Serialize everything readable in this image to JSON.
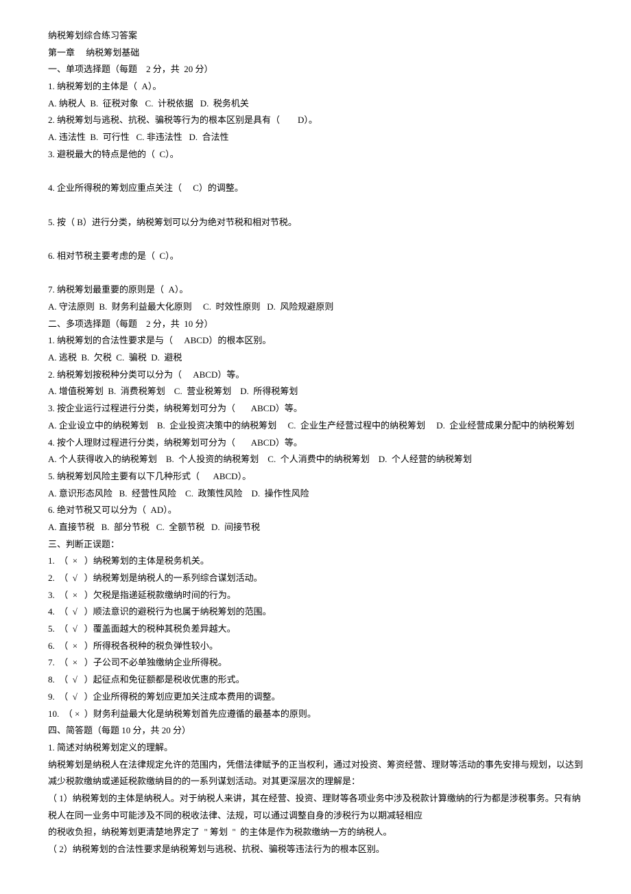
{
  "lines": [
    "纳税筹划综合练习答案",
    "第一章     纳税筹划基础",
    "一、单项选择题（每题    2 分，共  20 分）",
    "1. 纳税筹划的主体是（  A）。",
    "A. 纳税人  B.  征税对象   C.  计税依据   D.  税务机关",
    "2. 纳税筹划与逃税、抗税、骗税等行为的根本区别是具有（        D）。",
    "A. 违法性  B.  可行性   C. 非违法性   D.  合法性",
    "3. 避税最大的特点是他的（  C）。",
    "",
    "4. 企业所得税的筹划应重点关注（     C）的调整。",
    "",
    "5. 按（ B）进行分类，纳税筹划可以分为绝对节税和相对节税。",
    "",
    "6. 相对节税主要考虑的是（  C）。",
    "",
    "7. 纳税筹划最重要的原则是（  A）。",
    "A. 守法原则  B.  财务利益最大化原则     C.  时效性原则   D.  风险规避原则",
    "二、多项选择题（每题    2 分，共  10 分）",
    "1. 纳税筹划的合法性要求是与（     ABCD）的根本区别。",
    "A. 逃税  B.  欠税  C.  骗税  D.  避税",
    "2. 纳税筹划按税种分类可以分为（     ABCD）等。",
    "A. 增值税筹划  B.  消费税筹划    C.  营业税筹划    D.  所得税筹划",
    "3. 按企业运行过程进行分类，纳税筹划可分为（       ABCD）等。",
    "A. 企业设立中的纳税筹划    B.  企业投资决策中的纳税筹划     C.  企业生产经营过程中的纳税筹划     D.  企业经营成果分配中的纳税筹划",
    "4. 按个人理财过程进行分类，纳税筹划可分为（       ABCD）等。",
    "A. 个人获得收入的纳税筹划    B.  个人投资的纳税筹划    C.  个人消费中的纳税筹划    D.  个人经营的纳税筹划",
    "5. 纳税筹划风险主要有以下几种形式（      ABCD）。",
    "A. 意识形态风险   B.  经营性风险    C.  政策性风险    D.  操作性风险",
    "6. 绝对节税又可以分为（  AD）。",
    "A. 直接节税   B.  部分节税   C.  全额节税   D.  间接节税",
    "三、判断正误题：",
    "1.  （  ×   ）纳税筹划的主体是税务机关。",
    "2.  （  √   ）纳税筹划是纳税人的一系列综合谋划活动。",
    "3.  （  ×   ）欠税是指递延税款缴纳时间的行为。",
    "4.  （  √   ）顺法意识的避税行为也属于纳税筹划的范围。",
    "5.  （  √   ）覆盖面越大的税种其税负差异越大。",
    "6.  （  ×   ）所得税各税种的税负弹性较小。",
    "7.  （  ×   ）子公司不必单独缴纳企业所得税。",
    "8.  （  √   ）起征点和免征额都是税收优惠的形式。",
    "9.  （  √   ）企业所得税的筹划应更加关注成本费用的调整。",
    "10.  （ ×  ）财务利益最大化是纳税筹划首先应遵循的最基本的原则。",
    "四、简答题（每题 10 分，共 20 分）",
    "1. 简述对纳税筹划定义的理解。",
    "纳税筹划是纳税人在法律规定允许的范围内，凭借法律赋予的正当权利，通过对投资、筹资经营、理财等活动的事先安排与规划，以达到减少税款缴纳或递延税款缴纳目的的一系列谋划活动。对其更深层次的理解是：",
    "（ 1）纳税筹划的主体是纳税人。对于纳税人来讲，其在经营、投资、理财等各项业务中涉及税款计算缴纳的行为都是涉税事务。只有纳税人在同一业务中可能涉及不同的税收法律、法规，可以通过调整自身的涉税行为以期减轻相应",
    "的税收负担，纳税筹划更清楚地界定了  \" 筹划  \"  的主体是作为税款缴纳一方的纳税人。",
    "（ 2）纳税筹划的合法性要求是纳税筹划与逃税、抗税、骗税等违法行为的根本区别。"
  ]
}
